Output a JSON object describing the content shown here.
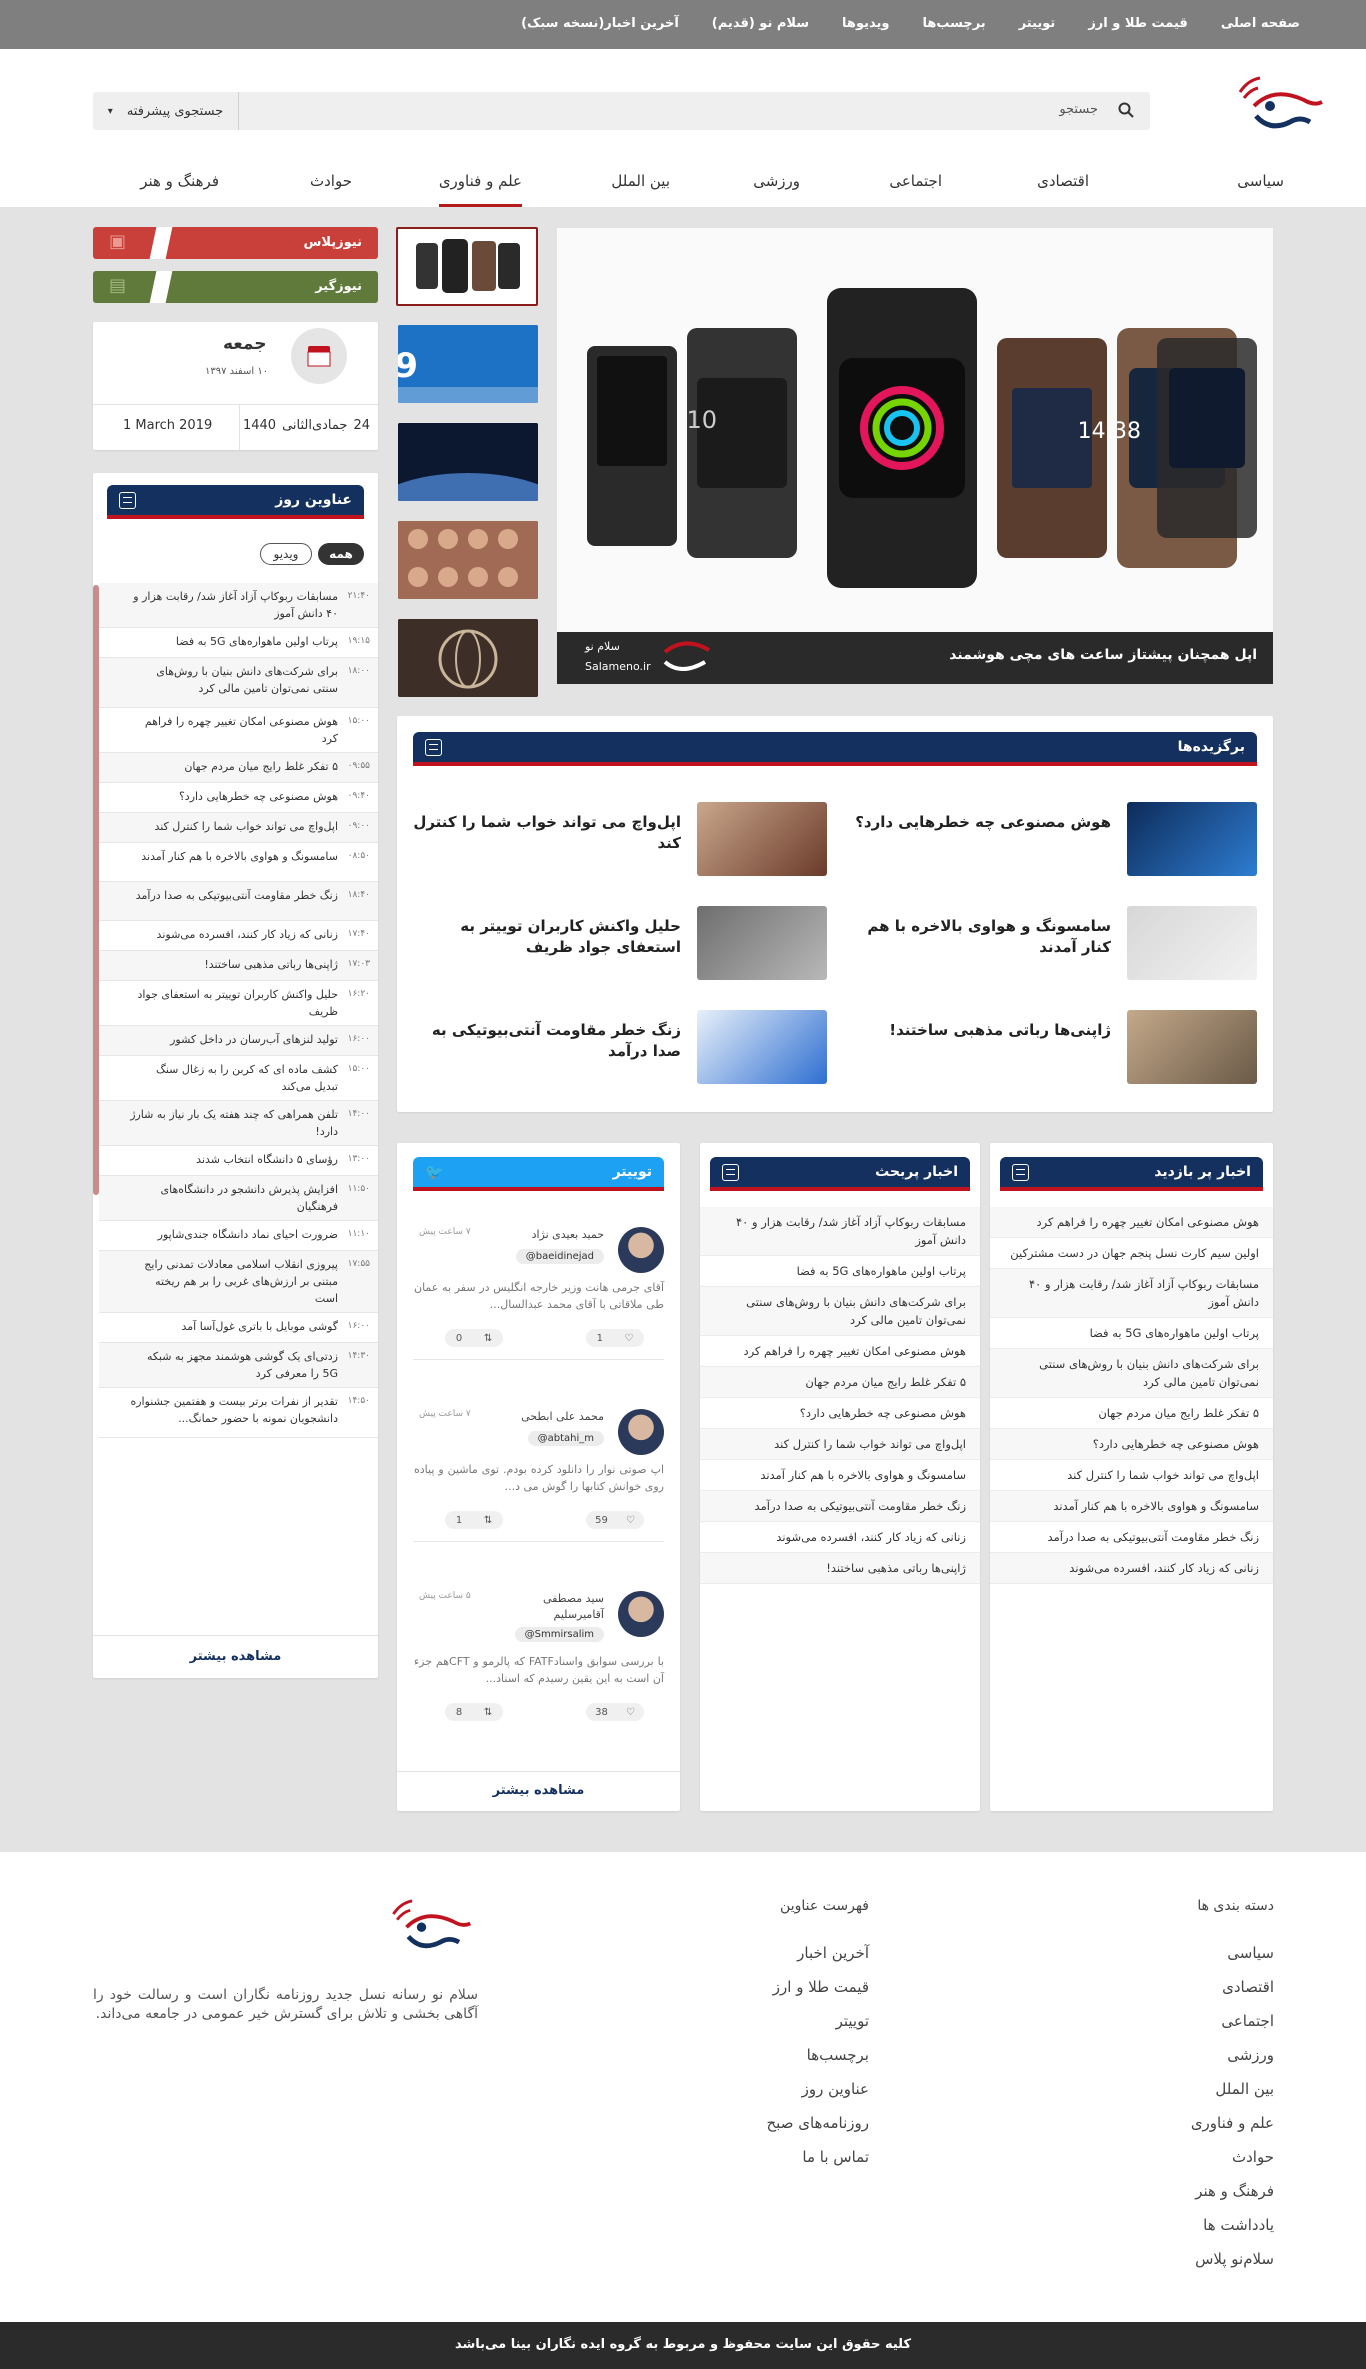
{
  "topnav": [
    "صفحه اصلی",
    "قیمت طلا و ارز",
    "توییتر",
    "برچسب‌ها",
    "ویدیوها",
    "سلام نو (قدیم)",
    "آخرین اخبار(نسخه سبک)"
  ],
  "search": {
    "placeholder": "جستجو",
    "advanced": "جستجوی پیشرفته"
  },
  "categories": [
    "سیاسی",
    "اقتصادی",
    "اجتماعی",
    "ورزشی",
    "بین الملل",
    "علم و فناوری",
    "حوادث",
    "فرهنگ و هنر"
  ],
  "hero": {
    "caption": "اپل همچنان پیشتاز ساعت های مچی هوشمند",
    "brand_fa": "سلام نو",
    "brand_en": "Salameno.ir"
  },
  "side_buttons": {
    "plus": "نیوزپلاس",
    "graph": "نیوزگیر"
  },
  "date": {
    "day": "جمعه",
    "shamsi": "۱۰ اسفند ۱۳۹۷",
    "hijri_day": "24",
    "hijri_month": "جمادی‌الثانی",
    "hijri_year": "1440",
    "greg": "1 March 2019"
  },
  "headlines": {
    "title": "عناوین روز",
    "tab_all": "همه",
    "tab_video": "ویدیو",
    "more": "مشاهده بیشتر",
    "items": [
      {
        "time": "۲۱:۴۰",
        "text": "مسابقات ربوکاپ آزاد آغاز شد/ رقابت هزار و ۴۰ دانش آموز"
      },
      {
        "time": "۱۹:۱۵",
        "text": "پرتاب اولین ماهواره‌های 5G به فضا"
      },
      {
        "time": "۱۸:۰۰",
        "text": "برای شرکت‌های دانش بنیان با روش‌های سنتی نمی‌توان تامین مالی کرد"
      },
      {
        "time": "۱۵:۰۰",
        "text": "هوش مصنوعی امکان تغییر چهره را فراهم کرد"
      },
      {
        "time": "۰۹:۵۵",
        "text": "۵ تفکر غلط رایج میان مردم جهان"
      },
      {
        "time": "۰۹:۴۰",
        "text": "هوش مصنوعی چه خطرهایی دارد؟"
      },
      {
        "time": "۰۹:۰۰",
        "text": "اپل‌واچ می تواند خواب شما را کنترل کند"
      },
      {
        "time": "۰۸:۵۰",
        "text": "سامسونگ و هواوی بالاخره با هم کنار آمدند"
      },
      {
        "time": "۱۸:۴۰",
        "text": "زنگ خطر مقاومت آنتی‌بیوتیکی به صدا درآمد"
      },
      {
        "time": "۱۷:۴۰",
        "text": "زنانی که زیاد کار کنند، افسرده می‌شوند"
      },
      {
        "time": "۱۷:۰۳",
        "text": "ژاپنی‌ها رباتی مذهبی ساختند!"
      },
      {
        "time": "۱۶:۲۰",
        "text": "حلیل واکنش کاربران توییتر به استعفای جواد ظریف"
      },
      {
        "time": "۱۶:۰۰",
        "text": "تولید لنزهای آب‌رسان در داخل کشور"
      },
      {
        "time": "۱۵:۰۰",
        "text": "کشف ماده ای که کربن را به زغال سنگ تبدیل می‌کند"
      },
      {
        "time": "۱۴:۰۰",
        "text": "تلفن همراهی که چند هفته یک بار نیاز به شارژ دارد!"
      },
      {
        "time": "۱۳:۰۰",
        "text": "رؤسای ۵ دانشگاه انتخاب شدند"
      },
      {
        "time": "۱۱:۵۰",
        "text": "افزایش پذیرش دانشجو در دانشگاه‌های فرهنگیان"
      },
      {
        "time": "۱۱:۱۰",
        "text": "ضرورت احیای نماد دانشگاه جندی‌شاپور"
      },
      {
        "time": "۱۷:۵۵",
        "text": "پیروزی انقلاب اسلامی معادلات تمدنی رایج مبتنی بر ارزش‌های غربی را بر هم ریخته است"
      },
      {
        "time": "۱۶:۰۰",
        "text": "گوشی موبایل با باتری غول‌آسا آمد"
      },
      {
        "time": "۱۴:۳۰",
        "text": "زدتی‌ای یک گوشی هوشمند مجهز به شبکه 5G را معرفی کرد"
      },
      {
        "time": "۱۴:۵۰",
        "text": "تقدیر از نفرات برتر بیست و هفتمین جشنواره دانشجویان نمونه با حضور حمانگ..."
      }
    ]
  },
  "featured": {
    "title": "برگزیده‌ها",
    "items": [
      {
        "text": "هوش مصنوعی چه خطرهایی دارد؟"
      },
      {
        "text": "اپل‌واچ می تواند خواب شما را کنترل کند"
      },
      {
        "text": "سامسونگ و هواوی بالاخره با هم کنار آمدند"
      },
      {
        "text": "حلیل واکنش کاربران توییتر به استعفای جواد ظریف"
      },
      {
        "text": "ژاپنی‌ها رباتی مذهبی ساختند!"
      },
      {
        "text": "زنگ خطر مقاومت آنتی‌بیوتیکی به صدا درآمد"
      }
    ]
  },
  "most_visited": {
    "title": "اخبار پر بازدید",
    "items": [
      "هوش مصنوعی امکان تغییر چهره را فراهم کرد",
      "اولین سیم کارت نسل پنجم جهان در دست مشترکین",
      "مسابقات ربوکاپ آزاد آغاز شد/ رقابت هزار و ۴۰ دانش آموز",
      "پرتاب اولین ماهواره‌های 5G به فضا",
      "برای شرکت‌های دانش بنیان با روش‌های سنتی نمی‌توان تامین مالی کرد",
      "۵ تفکر غلط رایج میان مردم جهان",
      "هوش مصنوعی چه خطرهایی دارد؟",
      "اپل‌واچ می تواند خواب شما را کنترل کند",
      "سامسونگ و هواوی بالاخره با هم کنار آمدند",
      "زنگ خطر مقاومت آنتی‌بیوتیکی به صدا درآمد",
      "زنانی که زیاد کار کنند، افسرده می‌شوند"
    ]
  },
  "hot_news": {
    "title": "اخبار پربحث",
    "items": [
      "مسابقات ربوکاپ آزاد آغاز شد/ رقابت هزار و ۴۰ دانش آموز",
      "پرتاب اولین ماهواره‌های 5G به فضا",
      "برای شرکت‌های دانش بنیان با روش‌های سنتی نمی‌توان تامین مالی کرد",
      "هوش مصنوعی امکان تغییر چهره را فراهم کرد",
      "۵ تفکر غلط رایج میان مردم جهان",
      "هوش مصنوعی چه خطرهایی دارد؟",
      "اپل‌واچ می تواند خواب شما را کنترل کند",
      "سامسونگ و هواوی بالاخره با هم کنار آمدند",
      "زنگ خطر مقاومت آنتی‌بیوتیکی به صدا درآمد",
      "زنانی که زیاد کار کنند، افسرده می‌شوند",
      "ژاپنی‌ها رباتی مذهبی ساختند!"
    ]
  },
  "twitter": {
    "title": "توییتر",
    "more": "مشاهده بیشتر",
    "tweets": [
      {
        "name": "حمید بعیدی نژاد",
        "handle": "@baeidinejad",
        "time": "۷ ساعت پیش",
        "text": "آقای جرمی هانت وزیر خارجه انگلیس در سفر به عمان طی ملاقاتی با آقای محمد عبدالسال...",
        "retweets": "0",
        "likes": "1"
      },
      {
        "name": "محمد علی ابطحی",
        "handle": "@abtahi_m",
        "time": "۷ ساعت پیش",
        "text": "اپ صوتی نوار را دانلود کرده بودم. توی ماشین و پیاده روی خوانش کتابها را گوش می د...",
        "retweets": "1",
        "likes": "59"
      },
      {
        "name": "سید مصطفی آقامیرسلیم",
        "handle": "@Smmirsalim",
        "time": "۵ ساعت پیش",
        "text": "با بررسی سوابق واسنادFATF که پالرمو و CFTهم جزء آن است به این یقین رسیدم که اسناد...",
        "retweets": "8",
        "likes": "38"
      }
    ]
  },
  "footer": {
    "categories_title": "دسته بندی ها",
    "categories": [
      "سیاسی",
      "اقتصادی",
      "اجتماعی",
      "ورزشی",
      "بین الملل",
      "علم و فناوری",
      "حوادث",
      "فرهنگ و هنر",
      "یادداشت ها",
      "سلام‌نو پلاس"
    ],
    "links_title": "فهرست عناوین",
    "links": [
      "آخرین اخبار",
      "قیمت طلا و ارز",
      "توییتر",
      "برچسب‌ها",
      "عناوین روز",
      "روزنامه‌های صبح",
      "تماس با ما"
    ],
    "about": "سلام نو رسانه نسل جدید روزنامه نگاران است و رسالت خود را آگاهی بخشی و تلاش برای گسترش خیر عمومی در جامعه می‌داند.",
    "copyright": "کلیه حقوق این سایت محفوظ و مربوط به گروه ایده نگاران بینا می‌باشد"
  },
  "colors": {
    "navy": "#13305f",
    "red": "#c1121f",
    "twitter": "#1da1f2",
    "plus": "#c9403a",
    "graph": "#5f7a3a"
  }
}
